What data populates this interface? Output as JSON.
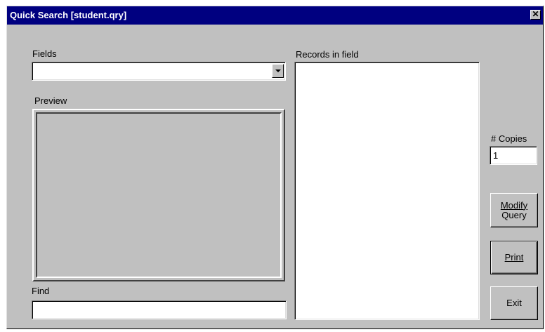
{
  "window": {
    "title": "Quick Search [student.qry]",
    "close_glyph": "✕"
  },
  "fields": {
    "label": "Fields",
    "value": ""
  },
  "preview": {
    "label": "Preview"
  },
  "find": {
    "label": "Find",
    "value": ""
  },
  "records": {
    "label": "Records in field",
    "items": []
  },
  "copies": {
    "label": "# Copies",
    "value": "1"
  },
  "buttons": {
    "modify_query_line1": "Modify",
    "modify_query_line2": "Query",
    "print": "Print",
    "exit": "Exit"
  },
  "icons": {
    "close": "close-icon",
    "dropdown": "chevron-down-icon"
  },
  "colors": {
    "titlebar": "#000080",
    "face": "#c0c0c0",
    "field": "#ffffff"
  }
}
